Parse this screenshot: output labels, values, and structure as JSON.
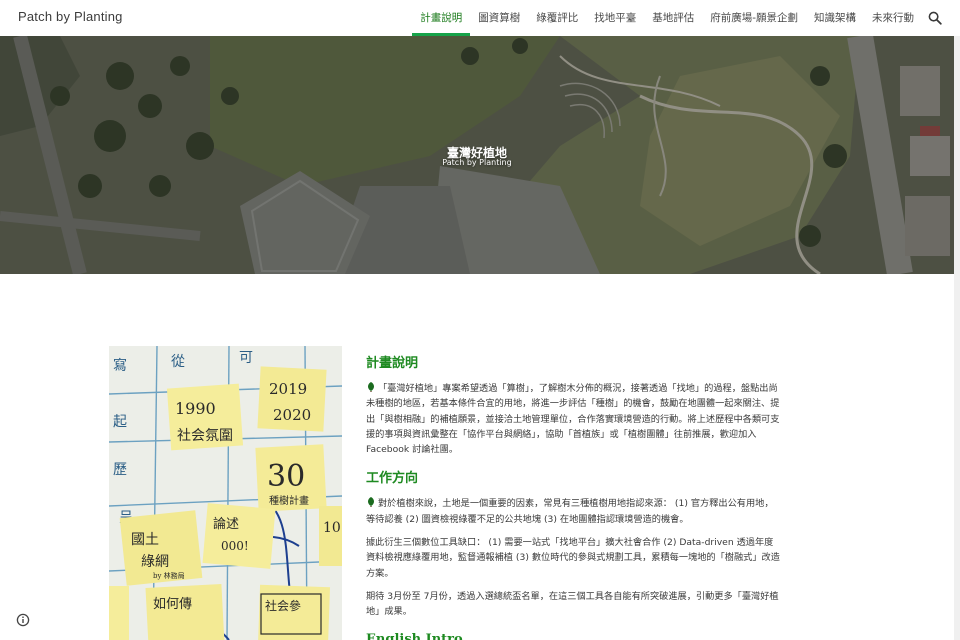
{
  "header": {
    "site_title": "Patch by Planting",
    "nav": [
      {
        "label": "計畫說明",
        "active": true
      },
      {
        "label": "圖資算樹",
        "active": false
      },
      {
        "label": "綠覆評比",
        "active": false
      },
      {
        "label": "找地平臺",
        "active": false
      },
      {
        "label": "基地評估",
        "active": false
      },
      {
        "label": "府前廣場-願景企劃",
        "active": false
      },
      {
        "label": "知識架構",
        "active": false
      },
      {
        "label": "未來行動",
        "active": false
      }
    ],
    "search_icon": "search-icon"
  },
  "hero": {
    "title": "臺灣好植地",
    "subtitle": "Patch by Planting"
  },
  "photo": {
    "notes": [
      "1990",
      "社会氛圍",
      "2019",
      "2020",
      "30",
      "種樹計畫",
      "國土",
      "綠網",
      "by 林務局",
      "論述",
      "000!",
      "如何傳",
      "社会參",
      "10"
    ]
  },
  "sections": {
    "plan": {
      "heading": "計畫說明",
      "p1": "「臺灣好植地」專案希望透過「算樹」，了解樹木分佈的概況，接著透過「找地」的過程，盤點出尚未種樹的地區，若基本條件合宜的用地，將進一步評估「種樹」的機會，鼓勵在地團體一起來關注、提出「與樹相融」的補植願景，並接洽土地管理單位，合作落實環境營造的行動。將上述歷程中各類可支援的事項與資訊彙整在「協作平台與網絡」，協助「首植族」或「植樹團體」往前推展，歡迎加入 Facebook 討論社團。"
    },
    "direction": {
      "heading": "工作方向",
      "p1": "對於植樹來說，土地是一個重要的因素，常見有三種植樹用地指認來源： (1) 官方釋出公有用地，等待認養 (2) 圖資檢視綠覆不足的公共地塊 (3) 在地團體指認環境營造的機會。",
      "p2": "據此衍生三個數位工具缺口： (1) 需要一站式「找地平台」擴大社會合作 (2) Data-driven 透過年度資料檢視應綠覆用地，監督通報補植 (3) 數位時代的參與式規劃工具，累積每一塊地的「樹融式」改造方案。",
      "p3": "期待 3月份至 7月份，透過入選總統盃名單，在這三個工具各自能有所突破進展，引動更多「臺灣好植地」成果。"
    },
    "english": {
      "heading": "English Intro"
    }
  },
  "icons": {
    "leaf": "leaf-icon",
    "info": "info-icon"
  },
  "colors": {
    "accent": "#1e8a21",
    "nav_underline": "#17a34a"
  }
}
